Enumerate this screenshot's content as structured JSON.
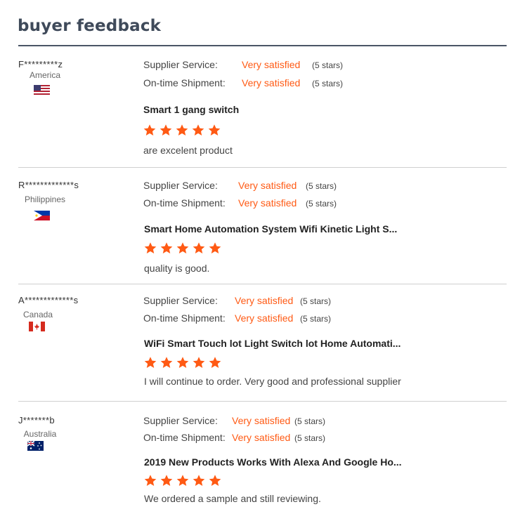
{
  "header": {
    "title": "buyer feedback"
  },
  "labels": {
    "supplier_service": "Supplier Service:",
    "on_time_shipment": "On-time Shipment:"
  },
  "accent_color": "#ff5a14",
  "reviews": [
    {
      "buyer": "F*********z",
      "country": "America",
      "flag_icon": "us-flag-icon",
      "supplier_service": {
        "value": "Very satisfied",
        "stars_text": "(5 stars)"
      },
      "on_time_shipment": {
        "value": "Very satisfied",
        "stars_text": "(5 stars)"
      },
      "product": "Smart 1 gang switch",
      "rating": 5,
      "comment": "are  excelent product"
    },
    {
      "buyer": "R*************s",
      "country": "Philippines",
      "flag_icon": "philippines-flag-icon",
      "supplier_service": {
        "value": "Very satisfied",
        "stars_text": "(5 stars)"
      },
      "on_time_shipment": {
        "value": "Very satisfied",
        "stars_text": "(5 stars)"
      },
      "product": "Smart Home Automation System Wifi Kinetic Light S...",
      "rating": 5,
      "comment": "quality is good."
    },
    {
      "buyer": "A*************s",
      "country": "Canada",
      "flag_icon": "canada-flag-icon",
      "supplier_service": {
        "value": "Very satisfied",
        "stars_text": "(5 stars)"
      },
      "on_time_shipment": {
        "value": "Very satisfied",
        "stars_text": "(5 stars)"
      },
      "product": "WiFi Smart Touch lot Light Switch lot Home Automati...",
      "rating": 5,
      "comment": "I will continue to order. Very good and professional supplier"
    },
    {
      "buyer": "J*******b",
      "country": "Australia",
      "flag_icon": "australia-flag-icon",
      "supplier_service": {
        "value": "Very satisfied",
        "stars_text": "(5 stars)"
      },
      "on_time_shipment": {
        "value": "Very satisfied",
        "stars_text": "(5 stars)"
      },
      "product": "2019 New Products Works With Alexa And Google Ho...",
      "rating": 5,
      "comment": "We ordered a sample and still reviewing."
    }
  ]
}
